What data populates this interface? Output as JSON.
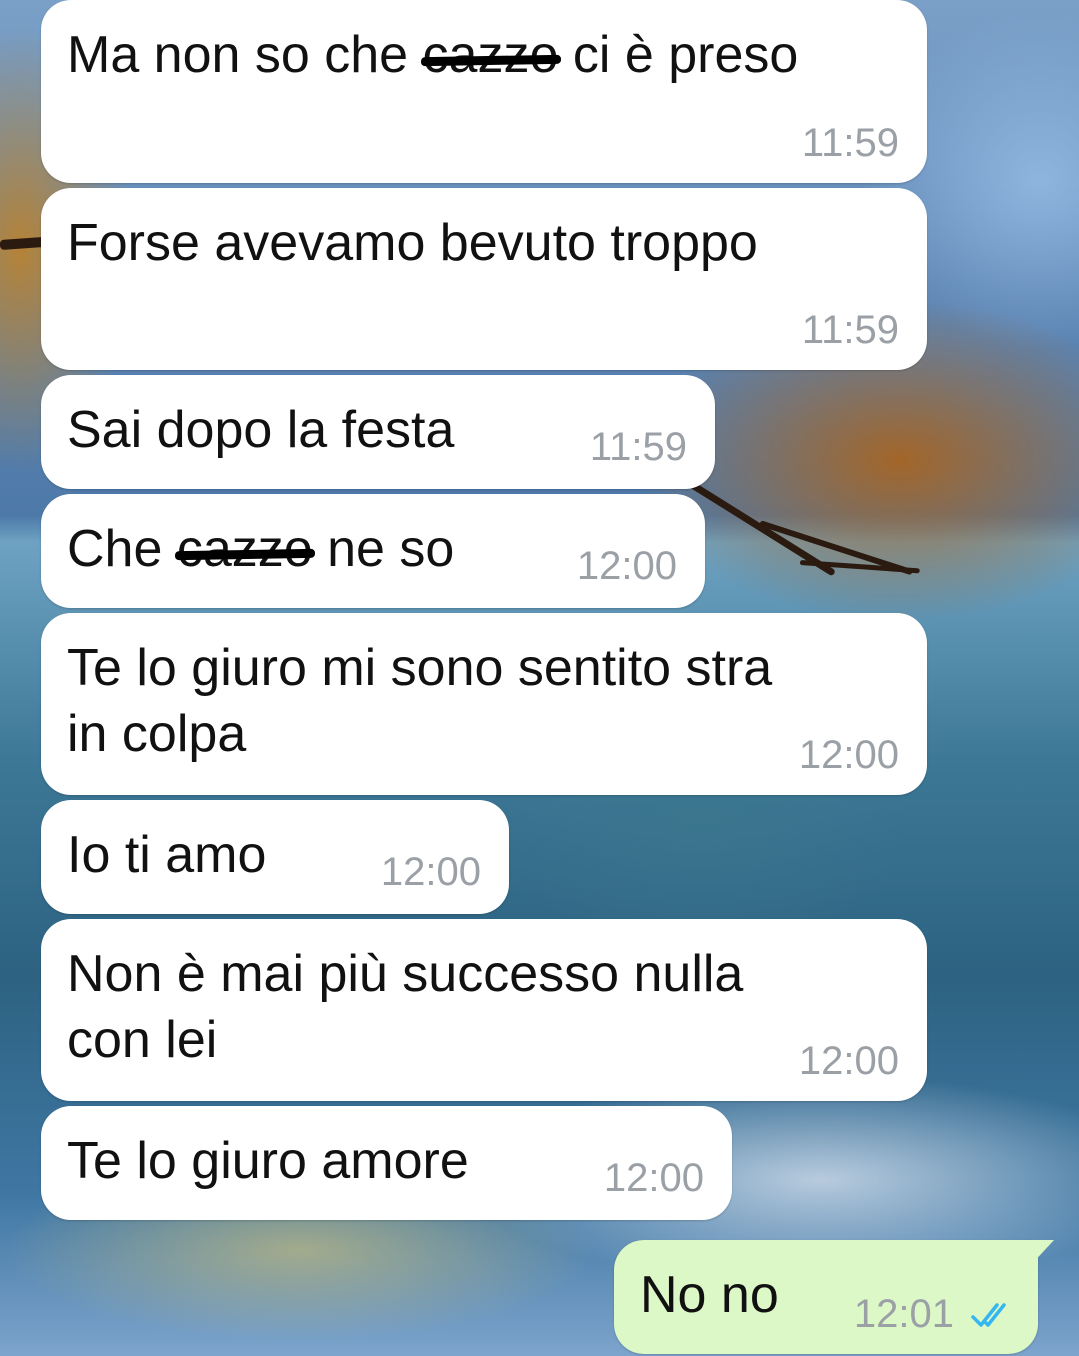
{
  "messages": [
    {
      "direction": "in",
      "parts": [
        {
          "text": "Ma non so che "
        },
        {
          "text": "cazzo",
          "censored": true
        },
        {
          "text": " ci è preso"
        }
      ],
      "time": "11:59"
    },
    {
      "direction": "in",
      "parts": [
        {
          "text": "Forse avevamo bevuto troppo"
        }
      ],
      "time": "11:59"
    },
    {
      "direction": "in",
      "parts": [
        {
          "text": "Sai dopo la festa"
        }
      ],
      "time": "11:59"
    },
    {
      "direction": "in",
      "parts": [
        {
          "text": "Che "
        },
        {
          "text": "cazzo",
          "censored": true
        },
        {
          "text": " ne so"
        }
      ],
      "time": "12:00"
    },
    {
      "direction": "in",
      "parts": [
        {
          "text": "Te lo giuro mi sono sentito stra\nin colpa"
        }
      ],
      "time": "12:00"
    },
    {
      "direction": "in",
      "parts": [
        {
          "text": "Io ti amo"
        }
      ],
      "time": "12:00"
    },
    {
      "direction": "in",
      "parts": [
        {
          "text": "Non è mai più successo nulla\ncon lei"
        }
      ],
      "time": "12:00"
    },
    {
      "direction": "in",
      "parts": [
        {
          "text": "Te lo giuro amore"
        }
      ],
      "time": "12:00"
    },
    {
      "direction": "out",
      "parts": [
        {
          "text": "No no"
        }
      ],
      "time": "12:01",
      "status_icon": "double-check-read-icon"
    }
  ],
  "colors": {
    "incoming_bubble": "#ffffff",
    "outgoing_bubble": "#dcf8c6",
    "timestamp": "#9aa0a6",
    "read_ticks": "#34b7f1"
  }
}
